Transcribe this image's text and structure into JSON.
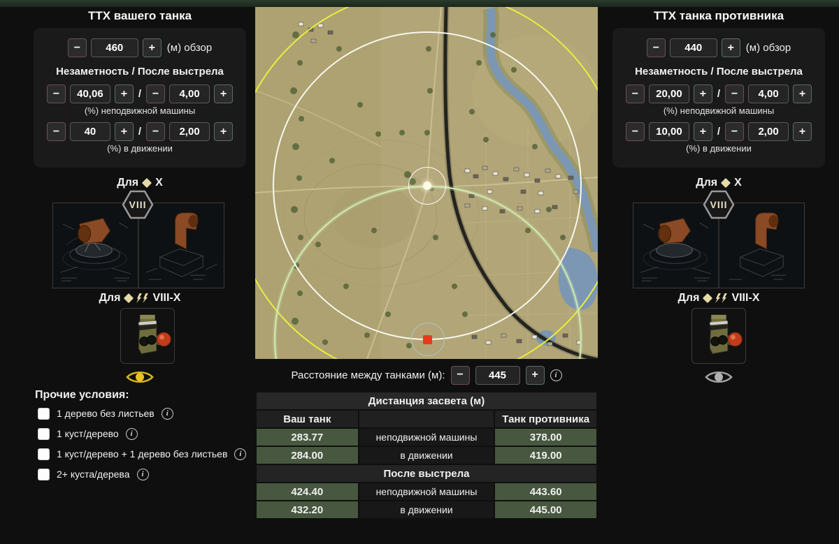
{
  "theme": {
    "page_bg": "#0e0f0e",
    "topbar_green": "#223325",
    "panel_bg": "#1a1a1a",
    "minus_border": "#6e4c5e",
    "plus_border": "#567060",
    "table_green_cell": "#48573f",
    "cream_accent": "#e6d9a8",
    "your_marker_color": "#fdfbe4",
    "enemy_marker_color": "#e8391f",
    "view_circle_color": "#f7f7ee",
    "render_circle_color": "#e8ed3f",
    "enemy_circle_color": "#cfeab2",
    "river_color": "#7b97b3",
    "eye_active_color": "#e2b714",
    "eye_inactive_color": "#a0a0a0"
  },
  "stepper": {
    "minus": "−",
    "plus": "+",
    "slash": "/"
  },
  "your_tank": {
    "title": "ТТХ вашего танка",
    "view_range_value": "460",
    "view_range_label": "(м) обзор",
    "camo_heading": "Незаметность / После выстрела",
    "stationary_camo": "40,06",
    "stationary_after_shot": "4,00",
    "stationary_caption": "(%) неподвижной машины",
    "moving_camo": "40",
    "moving_after_shot": "2,00",
    "moving_caption": "(%) в движении",
    "for_label": "Для",
    "tier_top": "X",
    "tier_badge": "VIII",
    "tier_range": "VIII-X"
  },
  "enemy_tank": {
    "title": "ТТХ танка противника",
    "view_range_value": "440",
    "view_range_label": "(м) обзор",
    "camo_heading": "Незаметность / После выстрела",
    "stationary_camo": "20,00",
    "stationary_after_shot": "4,00",
    "stationary_caption": "(%) неподвижной машины",
    "moving_camo": "10,00",
    "moving_after_shot": "2,00",
    "moving_caption": "(%) в движении",
    "for_label": "Для",
    "tier_top": "X",
    "tier_badge": "VIII",
    "tier_range": "VIII-X"
  },
  "distance": {
    "label": "Расстояние между танками (м):",
    "value": "445",
    "info": "i"
  },
  "conditions": {
    "heading": "Прочие условия:",
    "info": "i",
    "items": [
      {
        "label": "1 дерево без листьев",
        "checked": false
      },
      {
        "label": "1 куст/дерево",
        "checked": false
      },
      {
        "label": "1 куст/дерево + 1 дерево без листьев",
        "checked": false
      },
      {
        "label": "2+ куста/дерева",
        "checked": false
      }
    ]
  },
  "table": {
    "title": "Дистанция засвета (м)",
    "your_col": "Ваш танк",
    "enemy_col": "Танк противника",
    "rows": [
      {
        "your": "283.77",
        "label": "неподвижной машины",
        "enemy": "378.00"
      },
      {
        "your": "284.00",
        "label": "в движении",
        "enemy": "419.00"
      }
    ],
    "after_shot_title": "После выстрела",
    "after_rows": [
      {
        "your": "424.40",
        "label": "неподвижной машины",
        "enemy": "443.60"
      },
      {
        "your": "432.20",
        "label": "в движении",
        "enemy": "445.00"
      }
    ]
  }
}
